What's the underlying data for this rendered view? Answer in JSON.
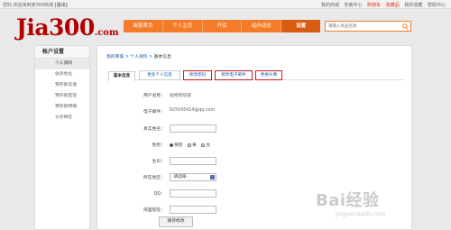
{
  "topbar": {
    "greeting": "您好",
    "user": "",
    "welcome": ",欢迎来到家300商城",
    "logout": "[退出]",
    "links": [
      "我的商城",
      "安装中心"
    ],
    "cart": "购物车",
    "favorites": "收藏品",
    "mine": "我的收藏",
    "help": "帮助中心"
  },
  "logo": {
    "text": "Jia300",
    "suffix": ".com"
  },
  "nav": {
    "items": [
      "商家首页",
      "个人主页",
      "开买",
      "站内动态",
      "设置"
    ],
    "active_index": 4
  },
  "search": {
    "placeholder": "请输入商品名称"
  },
  "sidebar": {
    "title": "帐户设置",
    "items": [
      "个人资料",
      "收货地址",
      "预存款充值",
      "预存款提现",
      "预存款明细",
      "分享绑定"
    ],
    "active_index": 0
  },
  "breadcrumb": {
    "home": "我的商城",
    "sep1": " > ",
    "mid": "个人资料",
    "sep2": " > ",
    "current": "基本信息"
  },
  "tabs": [
    "基本信息",
    "更多个人信息",
    "修改密码",
    "修改电子邮件",
    "更换头像"
  ],
  "form": {
    "username_label": "用户名称：",
    "username_value": "秘物惊现部",
    "email_label": "电子邮件：",
    "email_value": "825045414@qq.com",
    "realname_label": "真实姓名：",
    "gender_label": "性别：",
    "gender_options": [
      "保密",
      "男",
      "女"
    ],
    "birthday_label": "生日：",
    "region_label": "所在地区：",
    "region_value": "-请选择-",
    "qq_label": "QQ：",
    "aliwang_label": "阿里旺旺："
  },
  "save_button": "保存修改",
  "watermark": {
    "text": "Bai经验",
    "sub": "jingyan.baidu.com"
  },
  "colors": {
    "accent": "#f47b27",
    "brand": "#b40000",
    "link": "#1a5aa7",
    "highlight": "#d11a1a"
  }
}
